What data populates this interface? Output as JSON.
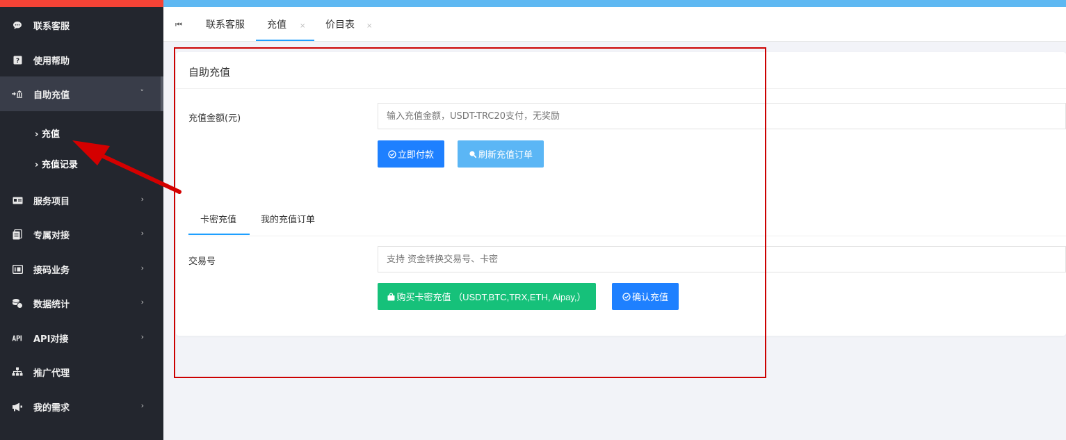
{
  "sidebar": {
    "items": [
      {
        "label": "联系客服",
        "icon": "chat-bubble-icon",
        "has_arrow": false
      },
      {
        "label": "使用帮助",
        "icon": "help-icon",
        "has_arrow": false
      },
      {
        "label": "自助充值",
        "icon": "recharge-icon",
        "has_arrow": true,
        "expanded": true
      },
      {
        "label": "服务项目",
        "icon": "id-card-icon",
        "has_arrow": true
      },
      {
        "label": "专属对接",
        "icon": "documents-icon",
        "has_arrow": true
      },
      {
        "label": "接码业务",
        "icon": "code-box-icon",
        "has_arrow": true
      },
      {
        "label": "数据统计",
        "icon": "coins-icon",
        "has_arrow": true
      },
      {
        "label": "API对接",
        "icon": "api-icon",
        "has_arrow": true
      },
      {
        "label": "推广代理",
        "icon": "sitemap-icon",
        "has_arrow": false
      },
      {
        "label": "我的需求",
        "icon": "megaphone-icon",
        "has_arrow": true
      }
    ],
    "subitems": [
      {
        "label": "充值",
        "active": true
      },
      {
        "label": "充值记录",
        "active": false
      }
    ]
  },
  "tabs": [
    {
      "label": "联系客服",
      "closable": false
    },
    {
      "label": "充值",
      "closable": true,
      "active": true
    },
    {
      "label": "价目表",
      "closable": true
    }
  ],
  "tab_close_glyph": "×",
  "card": {
    "title": "自助充值",
    "amount_label": "充值金额(元)",
    "amount_placeholder": "输入充值金额，USDT-TRC20支付，无奖励",
    "pay_button": "立即付款",
    "refresh_button": "刷新充值订单",
    "subtabs": [
      "卡密充值",
      "我的充值订单"
    ],
    "txn_label": "交易号",
    "txn_placeholder": "支持 资金转换交易号、卡密",
    "buy_button": "购买卡密充值 （USDT,BTC,TRX,ETH, Aipay,）",
    "confirm_button": "确认充值"
  },
  "colors": {
    "sidebar_bg": "#23262e",
    "primary_blue": "#1e80ff",
    "light_blue": "#5bb6f5",
    "green": "#16c17a",
    "annotation_red": "#cc0000"
  }
}
